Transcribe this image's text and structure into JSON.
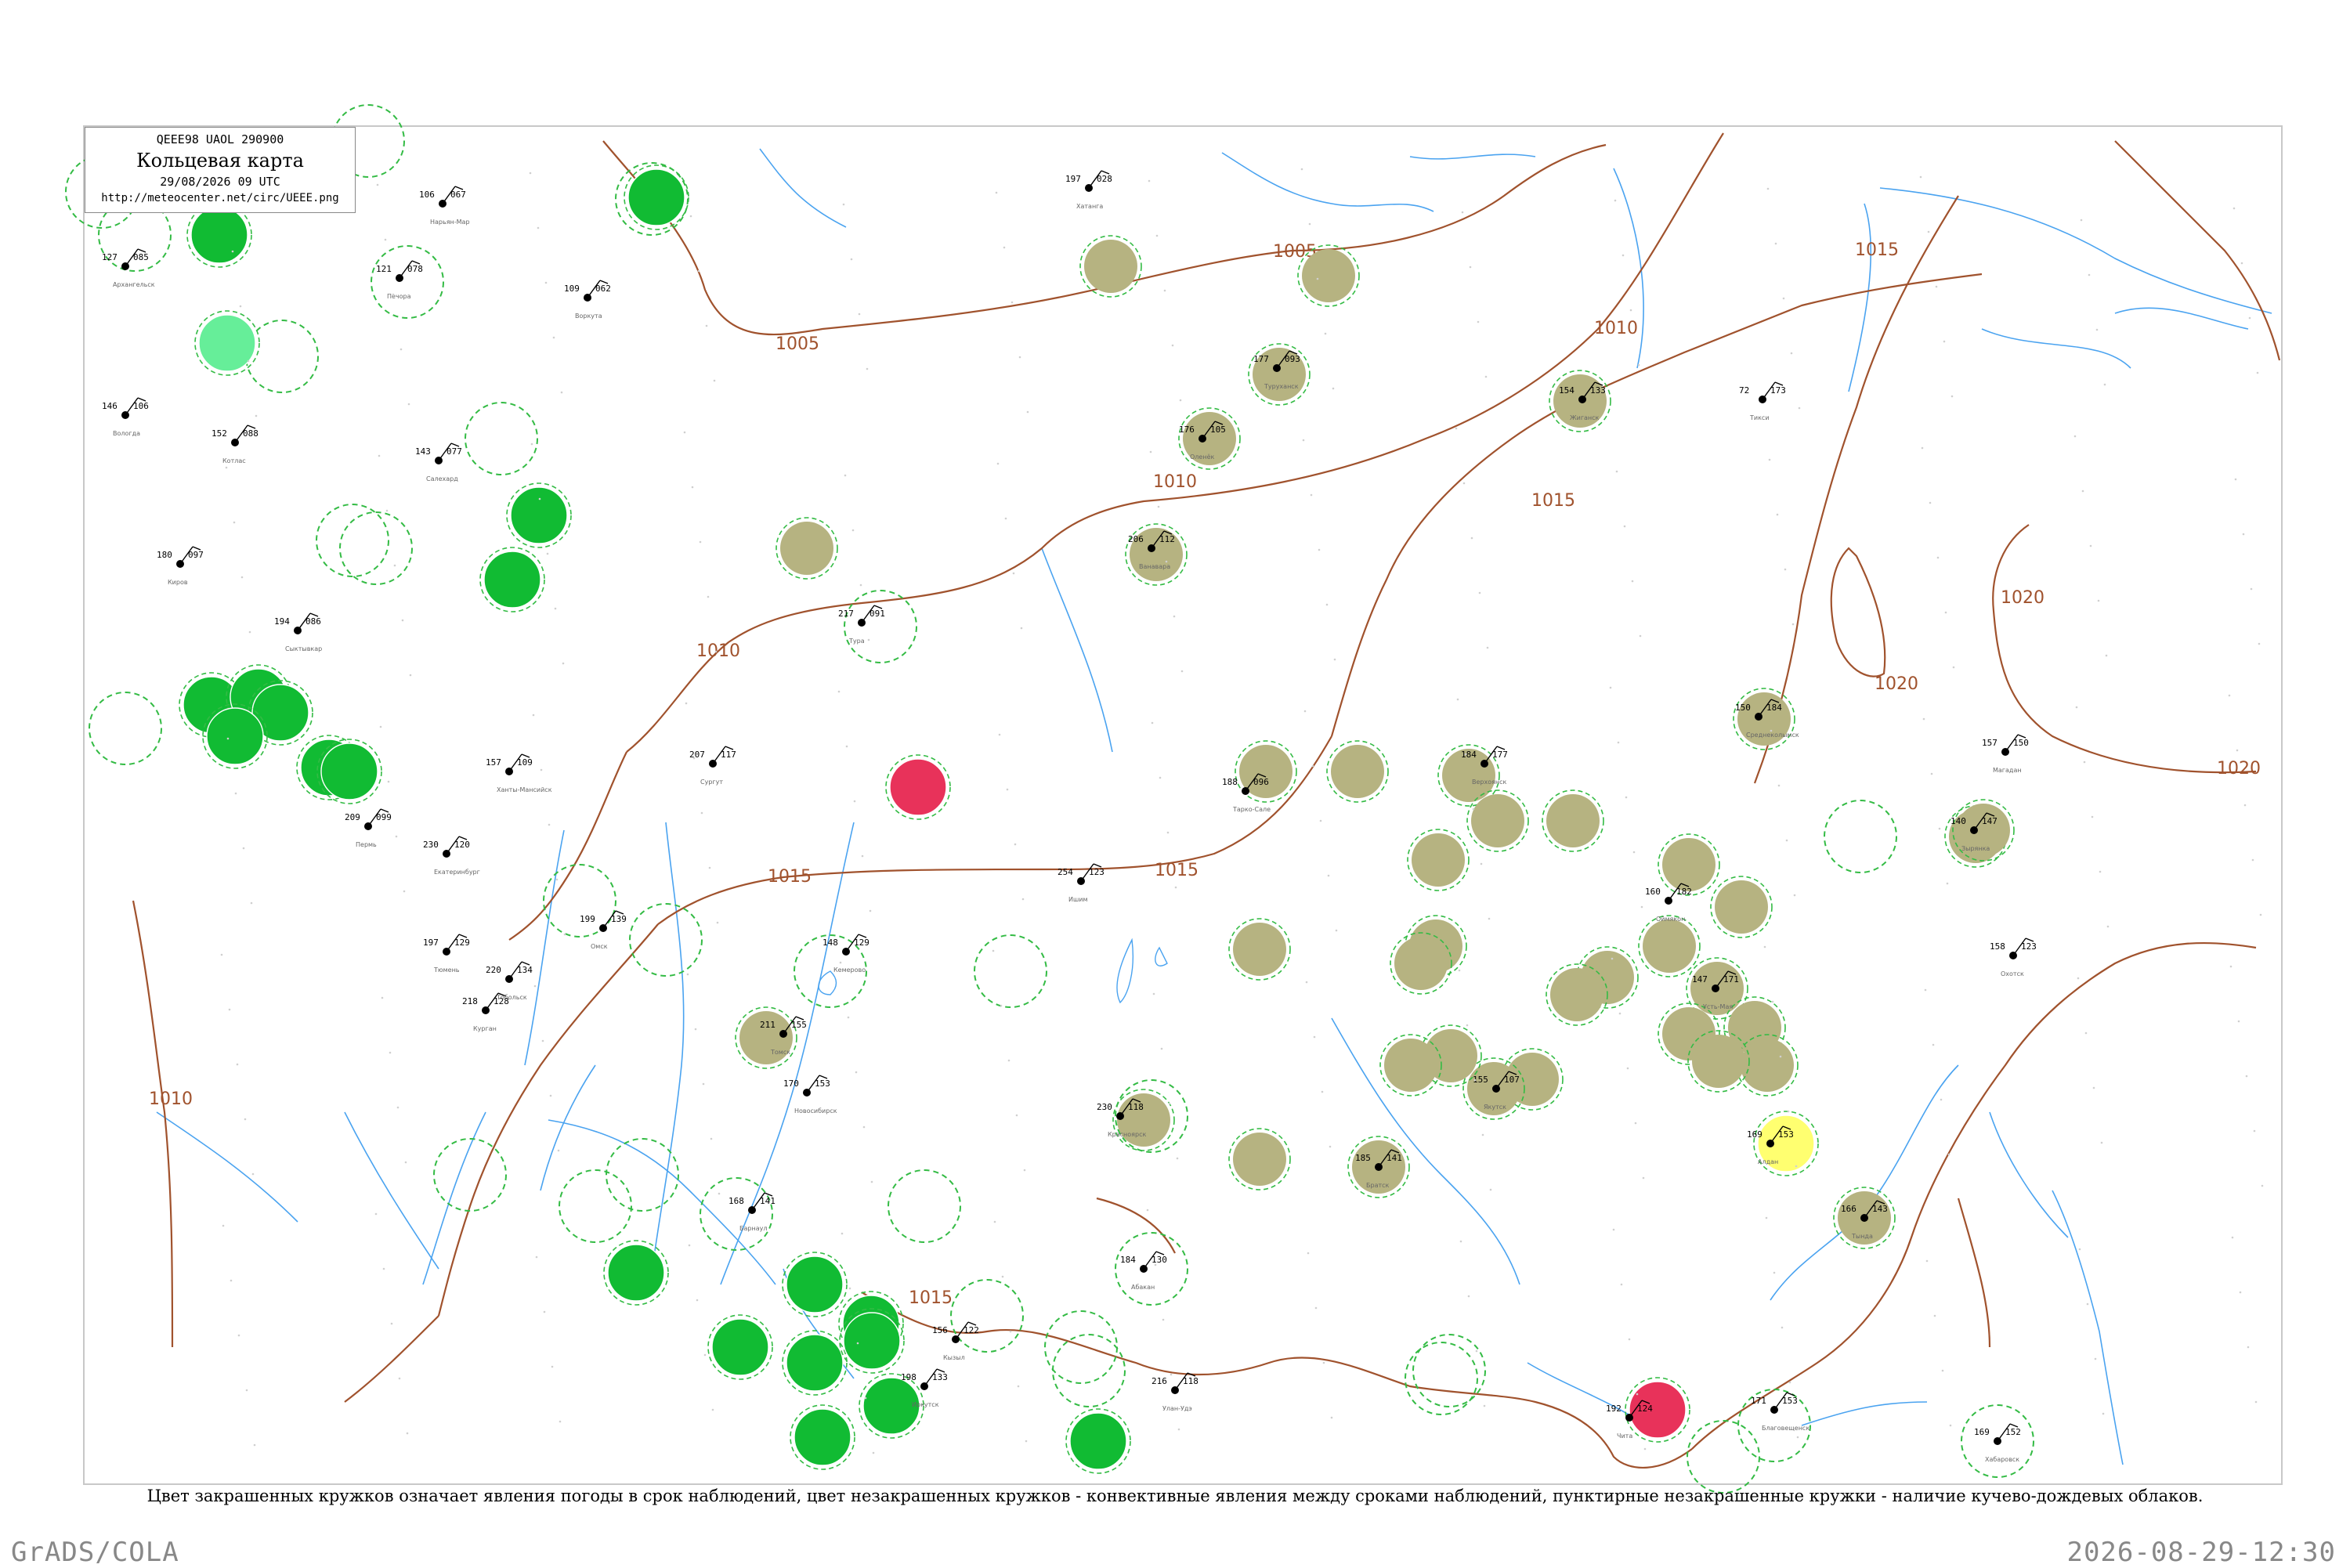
{
  "header": {
    "code": "QEEE98  UAOL  290900",
    "title": "Кольцевая карта",
    "date": "29/08/2026 09 UTC",
    "url": "http://meteocenter.net/circ/UEEE.png"
  },
  "legend_note": "Цвет закрашенных кружков означает явления погоды в срок наблюдений, цвет незакрашенных кружков - конвективные явления между сроками наблюдений, пунктирные незакрашенные кружки - наличие кучево-дождевых облаков.",
  "footer": {
    "left": "GrADS/COLA",
    "right": "2026-08-29-12:30"
  },
  "colors": {
    "isobar": "#a0522d",
    "river": "#4aa3f0",
    "rain": "#11bb33",
    "olive": "#b6b381",
    "thunder": "#e8325a",
    "yellow": "#ffff70",
    "cb_dashed": "#33bb44"
  },
  "isobar_labels": [
    "1005",
    "1005",
    "1010",
    "1010",
    "1010",
    "1015",
    "1015",
    "1015",
    "1015",
    "1015",
    "1020",
    "1020",
    "1020",
    "1010"
  ],
  "stations": [
    {
      "name": "Печора",
      "v1": "121",
      "v2": "078"
    },
    {
      "name": "Сыктывкар",
      "v1": "194",
      "v2": "086"
    },
    {
      "name": "Киров",
      "v1": "180",
      "v2": "097"
    },
    {
      "name": "Пермь",
      "v1": "209",
      "v2": "099"
    },
    {
      "name": "Екатеринбург",
      "v1": "230",
      "v2": "120"
    },
    {
      "name": "Тюмень",
      "v1": "197",
      "v2": "129"
    },
    {
      "name": "Курган",
      "v1": "218",
      "v2": "128"
    },
    {
      "name": "Омск",
      "v1": "199",
      "v2": "139"
    },
    {
      "name": "Новосибирск",
      "v1": "170",
      "v2": "153"
    },
    {
      "name": "Томск",
      "v1": "211",
      "v2": "155"
    },
    {
      "name": "Барнаул",
      "v1": "168",
      "v2": "141"
    },
    {
      "name": "Кемерово",
      "v1": "148",
      "v2": "129"
    },
    {
      "name": "Красноярск",
      "v1": "230",
      "v2": "118"
    },
    {
      "name": "Абакан",
      "v1": "184",
      "v2": "130"
    },
    {
      "name": "Кызыл",
      "v1": "156",
      "v2": "122"
    },
    {
      "name": "Иркутск",
      "v1": "198",
      "v2": "133"
    },
    {
      "name": "Братск",
      "v1": "185",
      "v2": "141"
    },
    {
      "name": "Улан-Удэ",
      "v1": "216",
      "v2": "118"
    },
    {
      "name": "Чита",
      "v1": "192",
      "v2": "124"
    },
    {
      "name": "Якутск",
      "v1": "155",
      "v2": "107"
    },
    {
      "name": "Тура",
      "v1": "217",
      "v2": "091"
    },
    {
      "name": "Ванавара",
      "v1": "206",
      "v2": "112"
    },
    {
      "name": "Туруханск",
      "v1": "177",
      "v2": "093"
    },
    {
      "name": "Хатанга",
      "v1": "197",
      "v2": "028"
    },
    {
      "name": "Оленёк",
      "v1": "176",
      "v2": "105"
    },
    {
      "name": "Жиганск",
      "v1": "154",
      "v2": "133"
    },
    {
      "name": "Верхоянск",
      "v1": "184",
      "v2": "177"
    },
    {
      "name": "Оймякон",
      "v1": "160",
      "v2": "182"
    },
    {
      "name": "Усть-Мая",
      "v1": "147",
      "v2": "171"
    },
    {
      "name": "Алдан",
      "v1": "169",
      "v2": "153"
    },
    {
      "name": "Тында",
      "v1": "166",
      "v2": "143"
    },
    {
      "name": "Благовещенск",
      "v1": "171",
      "v2": "153"
    },
    {
      "name": "Хабаровск",
      "v1": "169",
      "v2": "152"
    },
    {
      "name": "Магадан",
      "v1": "157",
      "v2": "150"
    },
    {
      "name": "Охотск",
      "v1": "158",
      "v2": "123"
    },
    {
      "name": "Зырянка",
      "v1": "140",
      "v2": "147"
    },
    {
      "name": "Среднеколымск",
      "v1": "150",
      "v2": "184"
    },
    {
      "name": "Тикси",
      "v1": "72",
      "v2": "173"
    },
    {
      "name": "Салехард",
      "v1": "143",
      "v2": "077"
    },
    {
      "name": "Ханты-Мансийск",
      "v1": "157",
      "v2": "109"
    },
    {
      "name": "Сургут",
      "v1": "207",
      "v2": "117"
    },
    {
      "name": "Тарко-Сале",
      "v1": "188",
      "v2": "096"
    },
    {
      "name": "Нарьян-Мар",
      "v1": "106",
      "v2": "067"
    },
    {
      "name": "Воркута",
      "v1": "109",
      "v2": "062"
    },
    {
      "name": "Архангельск",
      "v1": "127",
      "v2": "085"
    },
    {
      "name": "Котлас",
      "v1": "152",
      "v2": "088"
    },
    {
      "name": "Вологда",
      "v1": "146",
      "v2": "106"
    },
    {
      "name": "Тобольск",
      "v1": "220",
      "v2": "134"
    },
    {
      "name": "Ишим",
      "v1": "254",
      "v2": "123"
    }
  ]
}
